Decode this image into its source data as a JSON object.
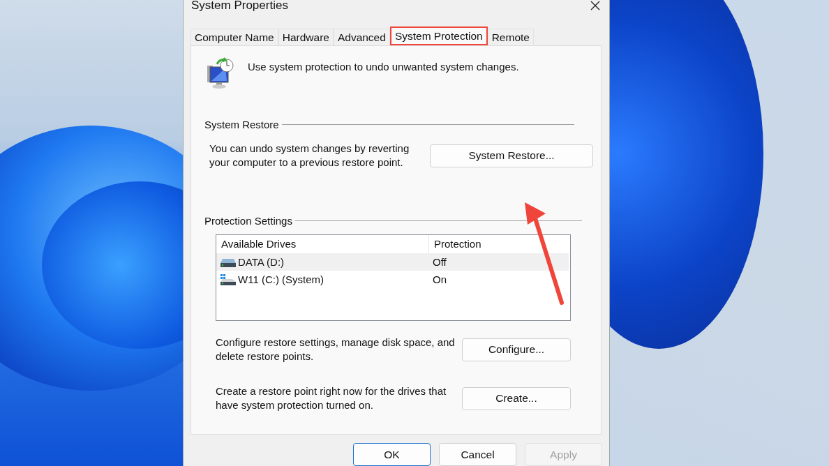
{
  "window": {
    "title": "System Properties"
  },
  "tabs": [
    {
      "label": "Computer Name",
      "selected": false,
      "highlighted": false
    },
    {
      "label": "Hardware",
      "selected": false,
      "highlighted": false
    },
    {
      "label": "Advanced",
      "selected": false,
      "highlighted": false
    },
    {
      "label": "System Protection",
      "selected": true,
      "highlighted": true
    },
    {
      "label": "Remote",
      "selected": false,
      "highlighted": false
    }
  ],
  "intro": "Use system protection to undo unwanted system changes.",
  "system_restore": {
    "heading": "System Restore",
    "description": "You can undo system changes by reverting your computer to a previous restore point.",
    "button": "System Restore..."
  },
  "protection_settings": {
    "heading": "Protection Settings",
    "columns": [
      "Available Drives",
      "Protection"
    ],
    "drives": [
      {
        "name": "DATA (D:)",
        "protection": "Off",
        "kind": "data",
        "selected": true
      },
      {
        "name": "W11 (C:) (System)",
        "protection": "On",
        "kind": "system",
        "selected": false
      }
    ],
    "actions": [
      {
        "description": "Configure restore settings, manage disk space, and delete restore points.",
        "button": "Configure..."
      },
      {
        "description": "Create a restore point right now for the drives that have system protection turned on.",
        "button": "Create..."
      }
    ]
  },
  "buttons": [
    {
      "label": "OK",
      "default": true,
      "disabled": false
    },
    {
      "label": "Cancel",
      "default": false,
      "disabled": false
    },
    {
      "label": "Apply",
      "default": false,
      "disabled": true
    }
  ],
  "annotation": {
    "arrow": true
  }
}
